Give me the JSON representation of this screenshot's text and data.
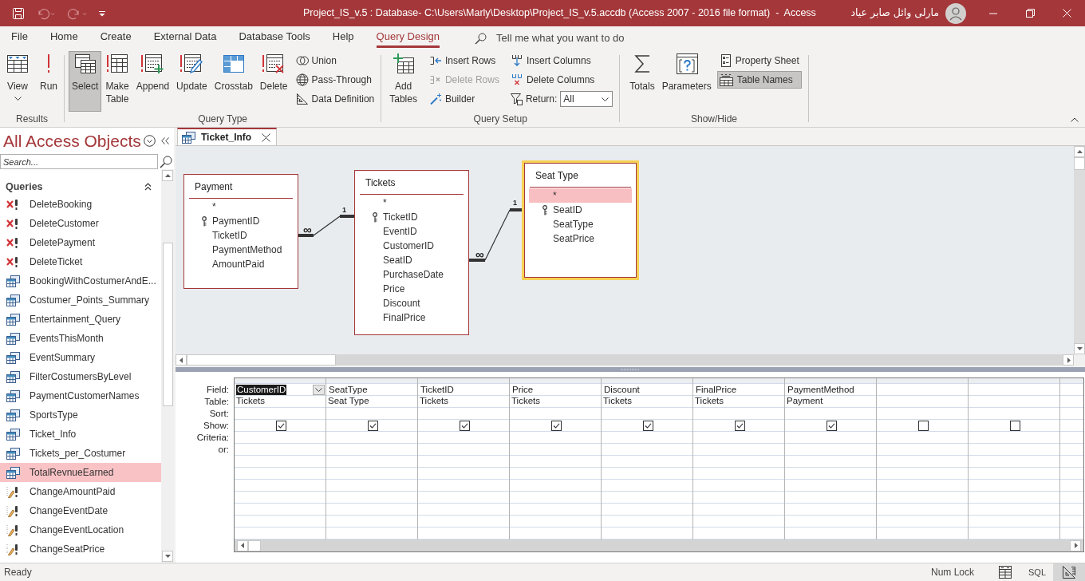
{
  "title_bar": {
    "quick_access": [
      {
        "kind": "save",
        "disabled": false
      },
      {
        "kind": "undo",
        "disabled": true
      },
      {
        "kind": "redo",
        "disabled": true
      },
      {
        "kind": "customize",
        "disabled": false
      }
    ],
    "title": "Project_IS_v.5 : Database- C:\\Users\\Marly\\Desktop\\Project_IS_v.5.accdb (Access 2007 - 2016 file format)  -  Access",
    "user": "مارلى وائل صابر عياد"
  },
  "menu_tabs": [
    {
      "label": "File",
      "selected": false
    },
    {
      "label": "Home",
      "selected": false
    },
    {
      "label": "Create",
      "selected": false
    },
    {
      "label": "External Data",
      "selected": false
    },
    {
      "label": "Database Tools",
      "selected": false
    },
    {
      "label": "Help",
      "selected": false
    },
    {
      "label": "Query Design",
      "selected": true
    }
  ],
  "tell_me": {
    "placeholder": "Tell me what you want to do"
  },
  "ribbon": {
    "groups": [
      {
        "label": "Results",
        "items": [
          {
            "label": "View",
            "kind": "split"
          },
          {
            "label": "Run",
            "kind": "large"
          }
        ]
      },
      {
        "label": "Query Type",
        "items": [
          {
            "label": "Select",
            "kind": "large",
            "selected": true
          },
          {
            "label": "Make Table",
            "kind": "large",
            "selected": false
          },
          {
            "label": "Append",
            "kind": "large",
            "selected": false
          },
          {
            "label": "Update",
            "kind": "large",
            "selected": false
          },
          {
            "label": "Crosstab",
            "kind": "large",
            "selected": false
          },
          {
            "label": "Delete",
            "kind": "large",
            "selected": false
          },
          {
            "label": "Union",
            "kind": "small",
            "selected": false
          },
          {
            "label": "Pass-Through",
            "kind": "small",
            "selected": false
          },
          {
            "label": "Data Definition",
            "kind": "small",
            "selected": false
          }
        ]
      },
      {
        "label": "Query Setup",
        "items": [
          {
            "label": "Add Tables",
            "kind": "large",
            "disabled": false
          },
          {
            "label": "Insert Rows",
            "kind": "small",
            "disabled": false
          },
          {
            "label": "Delete Rows",
            "kind": "small",
            "disabled": true
          },
          {
            "label": "Builder",
            "kind": "small",
            "disabled": false
          },
          {
            "label": "Insert Columns",
            "kind": "small",
            "disabled": false
          },
          {
            "label": "Delete Columns",
            "kind": "small",
            "disabled": false
          },
          {
            "label": "Return:",
            "kind": "dropdown",
            "value": "All",
            "disabled": false
          }
        ]
      },
      {
        "label": "Show/Hide",
        "items": [
          {
            "label": "Totals",
            "kind": "large",
            "selected": false
          },
          {
            "label": "Parameters",
            "kind": "large",
            "selected": false
          },
          {
            "label": "Property Sheet",
            "kind": "small",
            "selected": false
          },
          {
            "label": "Table Names",
            "kind": "small",
            "selected": true
          }
        ]
      }
    ]
  },
  "nav_pane": {
    "title": "All Access Objects",
    "search": {
      "placeholder": "Search..."
    },
    "section": {
      "label": "Queries",
      "expanded": true,
      "items": [
        {
          "label": "DeleteBooking",
          "kind": "delete",
          "selected": false
        },
        {
          "label": "DeleteCustomer",
          "kind": "delete",
          "selected": false
        },
        {
          "label": "DeletePayment",
          "kind": "delete",
          "selected": false
        },
        {
          "label": "DeleteTicket",
          "kind": "delete",
          "selected": false
        },
        {
          "label": "BookingWithCostumerAndE...",
          "kind": "select",
          "selected": false
        },
        {
          "label": "Costumer_Points_Summary",
          "kind": "select",
          "selected": false
        },
        {
          "label": "Entertainment_Query",
          "kind": "select",
          "selected": false
        },
        {
          "label": "EventsThisMonth",
          "kind": "select",
          "selected": false
        },
        {
          "label": "EventSummary",
          "kind": "select",
          "selected": false
        },
        {
          "label": "FilterCostumersByLevel",
          "kind": "select",
          "selected": false
        },
        {
          "label": "PaymentCustomerNames",
          "kind": "select",
          "selected": false
        },
        {
          "label": "SportsType",
          "kind": "select",
          "selected": false
        },
        {
          "label": "Ticket_Info",
          "kind": "select",
          "selected": false
        },
        {
          "label": "Tickets_per_Costumer",
          "kind": "select",
          "selected": false
        },
        {
          "label": "TotalRevnueEarned",
          "kind": "select",
          "selected": true
        },
        {
          "label": "ChangeAmountPaid",
          "kind": "update",
          "selected": false
        },
        {
          "label": "ChangeEventDate",
          "kind": "update",
          "selected": false
        },
        {
          "label": "ChangeEventLocation",
          "kind": "update",
          "selected": false
        },
        {
          "label": "ChangeSeatPrice",
          "kind": "update",
          "selected": false
        }
      ]
    }
  },
  "document_tabs": [
    {
      "label": "Ticket_Info",
      "selected": true
    }
  ],
  "diagram": {
    "tables": [
      {
        "name": "Payment",
        "selected": false,
        "fields": [
          {
            "name": "*",
            "key": false,
            "selected": false
          },
          {
            "name": "PaymentID",
            "key": true,
            "selected": false
          },
          {
            "name": "TicketID",
            "key": false,
            "selected": false
          },
          {
            "name": "PaymentMethod",
            "key": false,
            "selected": false
          },
          {
            "name": "AmountPaid",
            "key": false,
            "selected": false
          }
        ]
      },
      {
        "name": "Tickets",
        "selected": false,
        "fields": [
          {
            "name": "*",
            "key": false,
            "selected": false
          },
          {
            "name": "TicketID",
            "key": true,
            "selected": false
          },
          {
            "name": "EventID",
            "key": false,
            "selected": false
          },
          {
            "name": "CustomerID",
            "key": false,
            "selected": false
          },
          {
            "name": "SeatID",
            "key": false,
            "selected": false
          },
          {
            "name": "PurchaseDate",
            "key": false,
            "selected": false
          },
          {
            "name": "Price",
            "key": false,
            "selected": false
          },
          {
            "name": "Discount",
            "key": false,
            "selected": false
          },
          {
            "name": "FinalPrice",
            "key": false,
            "selected": false
          }
        ]
      },
      {
        "name": "Seat Type",
        "selected": true,
        "fields": [
          {
            "name": "*",
            "key": false,
            "selected": true
          },
          {
            "name": "SeatID",
            "key": true,
            "selected": false
          },
          {
            "name": "SeatType",
            "key": false,
            "selected": false
          },
          {
            "name": "SeatPrice",
            "key": false,
            "selected": false
          }
        ]
      }
    ],
    "relationships": [
      {
        "many_end": "∞",
        "one_end": "1"
      },
      {
        "many_end": "∞",
        "one_end": "1"
      }
    ]
  },
  "query_grid": {
    "row_labels": [
      "Field:",
      "Table:",
      "Sort:",
      "Show:",
      "Criteria:",
      "or:"
    ],
    "columns": [
      {
        "field": "CustomerID",
        "table": "Tickets",
        "show": true,
        "selected": true
      },
      {
        "field": "SeatType",
        "table": "Seat Type",
        "show": true,
        "selected": false
      },
      {
        "field": "TicketID",
        "table": "Tickets",
        "show": true,
        "selected": false
      },
      {
        "field": "Price",
        "table": "Tickets",
        "show": true,
        "selected": false
      },
      {
        "field": "Discount",
        "table": "Tickets",
        "show": true,
        "selected": false
      },
      {
        "field": "FinalPrice",
        "table": "Tickets",
        "show": true,
        "selected": false
      },
      {
        "field": "PaymentMethod",
        "table": "Payment",
        "show": true,
        "selected": false
      },
      {
        "show": false,
        "selected": false
      },
      {
        "show": false,
        "selected": false
      }
    ]
  },
  "status_bar": {
    "status": "Ready",
    "indicators": [
      "Num Lock"
    ],
    "views": [
      {
        "kind": "datasheet",
        "selected": false
      },
      {
        "kind": "sql",
        "label": "SQL",
        "selected": false
      },
      {
        "kind": "design",
        "selected": true
      }
    ]
  }
}
